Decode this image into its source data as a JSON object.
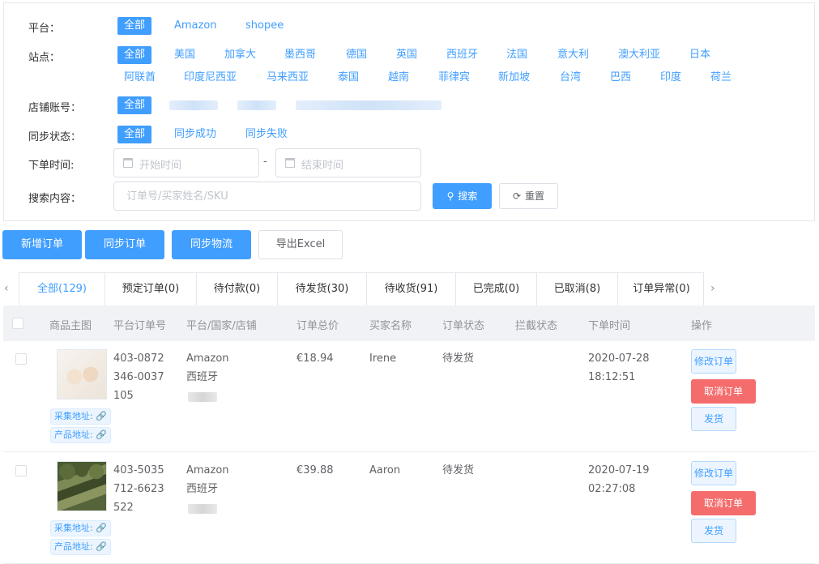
{
  "filters": {
    "platform": {
      "label": "平台：",
      "options": [
        "全部",
        "Amazon",
        "shopee"
      ]
    },
    "site": {
      "label": "站点：",
      "options_row1": [
        "全部",
        "美国",
        "加拿大",
        "墨西哥",
        "德国",
        "英国",
        "西班牙",
        "法国",
        "意大利",
        "澳大利亚",
        "日本"
      ],
      "options_row2": [
        "阿联酋",
        "印度尼西亚",
        "马来西亚",
        "泰国",
        "越南",
        "菲律宾",
        "新加坡",
        "台湾",
        "巴西",
        "印度",
        "荷兰"
      ]
    },
    "shop_account": {
      "label": "店铺账号：",
      "options": [
        "全部"
      ]
    },
    "sync_status": {
      "label": "同步状态：",
      "options": [
        "全部",
        "同步成功",
        "同步失败"
      ]
    },
    "order_time": {
      "label": "下单时间:",
      "start_placeholder": "开始时间",
      "end_placeholder": "结束时间",
      "separator": "-"
    },
    "search": {
      "label": "搜索内容：",
      "placeholder": "订单号/买家姓名/SKU",
      "search_button": "搜索",
      "reset_button": "重置"
    }
  },
  "actions": [
    "新增订单",
    "同步订单",
    "同步物流",
    "导出Excel"
  ],
  "tabs": [
    "全部(129)",
    "预定订单(0)",
    "待付款(0)",
    "待发货(30)",
    "待收货(91)",
    "已完成(0)",
    "已取消(8)",
    "订单异常(0)"
  ],
  "active_tab": 0,
  "table": {
    "headers": [
      "商品主图",
      "平台订单号",
      "平台/国家/店铺",
      "订单总价",
      "买家名称",
      "订单状态",
      "拦截状态",
      "下单时间",
      "操作"
    ],
    "rows": [
      {
        "order_no": [
          "403-0872",
          "346-0037",
          "105"
        ],
        "platform": "Amazon",
        "country": "西班牙",
        "total": "€18.94",
        "buyer": "Irene",
        "status": "待发货",
        "intercept": "",
        "date": "2020-07-28",
        "time": "18:12:51",
        "collect_link": "采集地址:",
        "product_link": "产品地址:",
        "op_edit": "修改订单",
        "op_cancel": "取消订单",
        "op_ship": "发货"
      },
      {
        "order_no": [
          "403-5035",
          "712-6623",
          "522"
        ],
        "platform": "Amazon",
        "country": "西班牙",
        "total": "€39.88",
        "buyer": "Aaron",
        "status": "待发货",
        "intercept": "",
        "date": "2020-07-19",
        "time": "02:27:08",
        "collect_link": "采集地址:",
        "product_link": "产品地址:",
        "op_edit": "修改订单",
        "op_cancel": "取消订单",
        "op_ship": "发货"
      }
    ]
  },
  "colors": {
    "primary": "#409eff",
    "danger": "#f56c6c",
    "header_bg": "#f0f2f5"
  }
}
